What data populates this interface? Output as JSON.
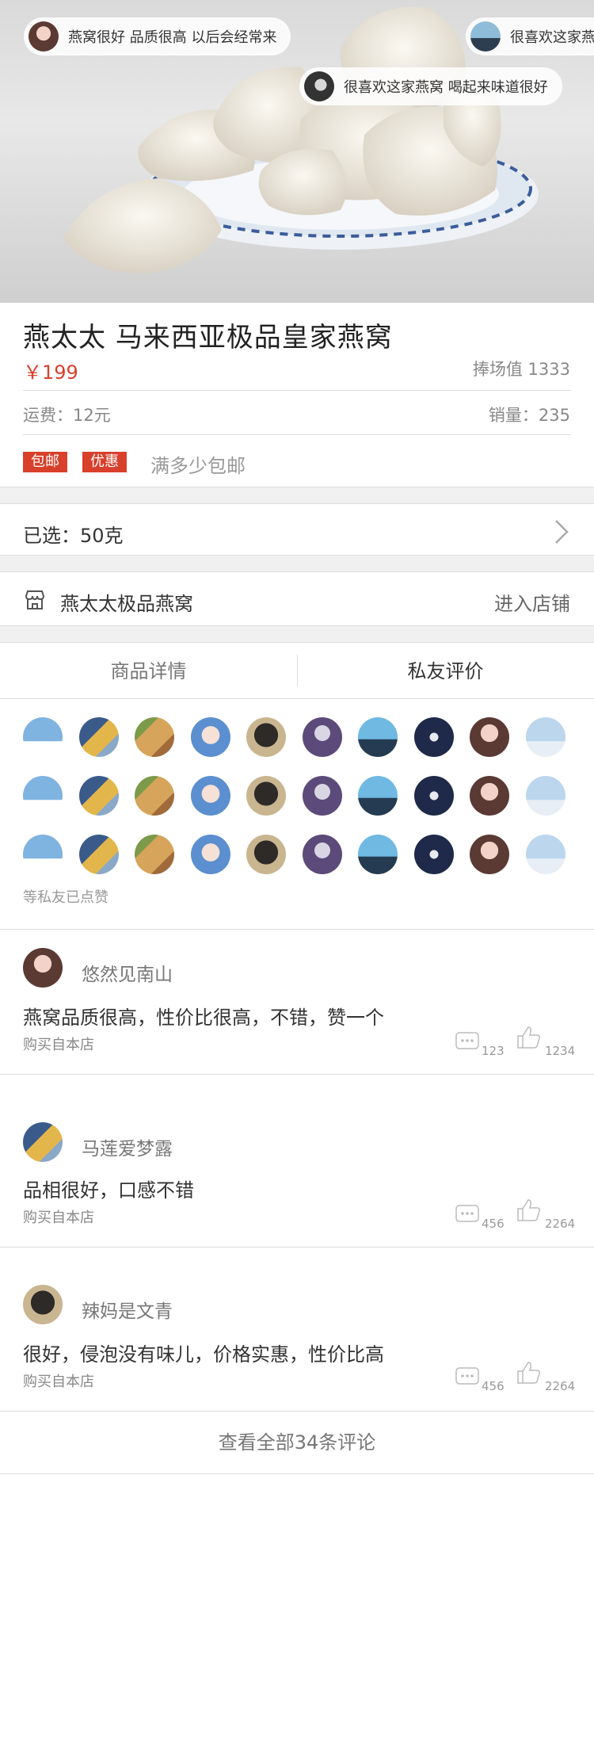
{
  "hero": {
    "danmaku": [
      {
        "text": "燕窝很好  品质很高 以后会经常来",
        "avatar": "woman-avatar"
      },
      {
        "text": "很喜欢这家燕窝",
        "avatar": "girl-back-avatar"
      },
      {
        "text": "很喜欢这家燕窝 喝起来味道很好",
        "avatar": "dark-hair-avatar"
      }
    ]
  },
  "product": {
    "title": "燕太太   马来西亚极品皇家燕窝",
    "price": "￥199",
    "pengchang": "捧场值   1333",
    "shipping": "运费：12元",
    "sales": "销量：235",
    "tags": [
      "包邮",
      "优惠"
    ],
    "tag_note": "满多少包邮"
  },
  "selection": {
    "label": "已选：50克"
  },
  "store": {
    "name": "燕太太极品燕窝",
    "enter": "进入店铺"
  },
  "tabs": [
    "商品详情",
    "私友评价"
  ],
  "friends": {
    "liked_note": "等私友已点赞"
  },
  "reviews": [
    {
      "name": "悠然见南山",
      "text": "燕窝品质很高，性价比很高，不错，赞一个",
      "source": "购买自本店",
      "comments": "123",
      "likes": "1234"
    },
    {
      "name": "马莲爱梦露",
      "text": "品相很好，口感不错",
      "source": "购买自本店",
      "comments": "456",
      "likes": "2264"
    },
    {
      "name": "辣妈是文青",
      "text": "很好，侵泡没有味儿，价格实惠，性价比高",
      "source": "购买自本店",
      "comments": "456",
      "likes": "2264"
    }
  ],
  "view_all": "查看全部34条评论",
  "colors": {
    "accent": "#d8402c",
    "divider": "#dddddd",
    "gap": "#f0f0f0"
  }
}
